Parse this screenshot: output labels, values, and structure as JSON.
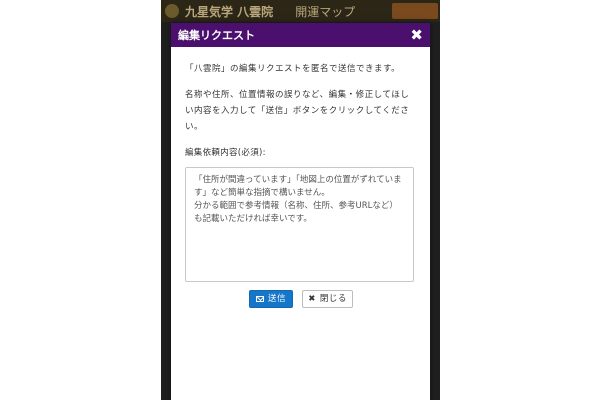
{
  "app": {
    "title": "九星気学 八雲院",
    "subtitle": "開運マップ"
  },
  "modal": {
    "title": "編集リクエスト",
    "close_icon": "✖",
    "intro": "「八雲院」の編集リクエストを匿名で送信できます。",
    "instructions": "名称や住所、位置情報の誤りなど、編集・修正してほしい内容を入力して「送信」ボタンをクリックしてください。",
    "field_label": "編集依頼内容(必須):",
    "textarea_value": "",
    "textarea_placeholder": "「住所が間違っています」「地図上の位置がずれています」など簡単な指摘で構いません。\n分かる範囲で参考情報（名称、住所、参考URLなど）も記載いただければ幸いです。",
    "send_label": "送信",
    "close_label": "閉じる"
  },
  "colors": {
    "modal_header": "#4b0f6e",
    "send_button": "#1677c9",
    "app_header": "#2c2617"
  },
  "icons": {
    "send": "mail-icon",
    "close_button": "x-icon",
    "header_close": "close-icon"
  }
}
